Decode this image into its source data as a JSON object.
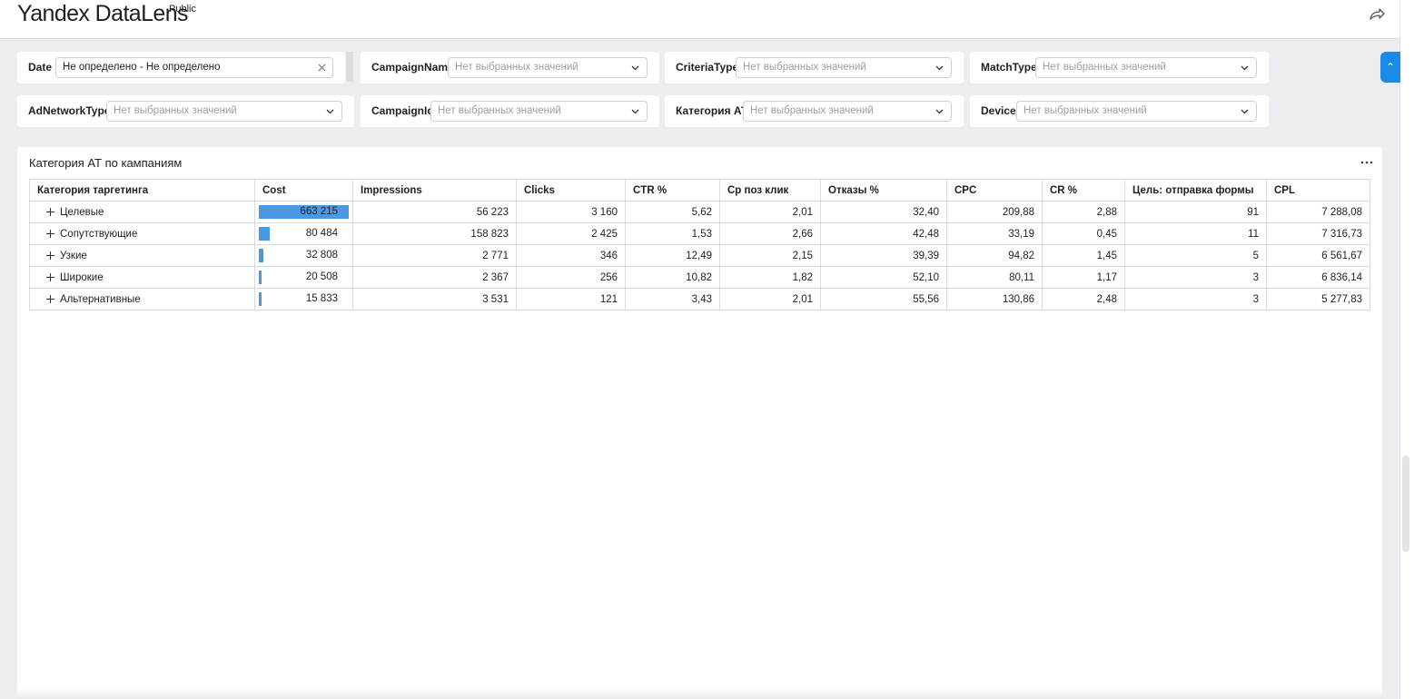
{
  "header": {
    "logo": "Yandex DataLens",
    "badge": "Public",
    "share_icon": "share-arrow-icon"
  },
  "filters": {
    "date": {
      "label": "Date",
      "value": "Не определено - Не определено"
    },
    "campaign_name": {
      "label": "CampaignName",
      "placeholder": "Нет выбранных значений"
    },
    "criteria_type": {
      "label": "CriteriaType",
      "placeholder": "Нет выбранных значений"
    },
    "match_type": {
      "label": "MatchType",
      "placeholder": "Нет выбранных значений"
    },
    "ad_network_type": {
      "label": "AdNetworkType",
      "placeholder": "Нет выбранных значений"
    },
    "campaign_id": {
      "label": "CampaignId",
      "placeholder": "Нет выбранных значений"
    },
    "category_at": {
      "label": "Категория АТ",
      "placeholder": "Нет выбранных значений"
    },
    "device": {
      "label": "Device",
      "placeholder": "Нет выбранных значений"
    }
  },
  "panel": {
    "title": "Категория АТ по кампаниям",
    "more_icon": "ellipsis-icon"
  },
  "table": {
    "columns": [
      "Категория таргетинга",
      "Cost",
      "Impressions",
      "Clicks",
      "CTR %",
      "Ср поз клик",
      "Отказы %",
      "CPC",
      "CR %",
      "Цель: отправка формы",
      "CPL"
    ],
    "rows": [
      {
        "cat": "Целевые",
        "cost": "663 215",
        "cost_fraction": 1.0,
        "impressions": "56 223",
        "clicks": "3 160",
        "ctr": "5,62",
        "pos": "2,01",
        "bounce": "32,40",
        "cpc": "209,88",
        "cr": "2,88",
        "goal": "91",
        "cpl": "7 288,08"
      },
      {
        "cat": "Сопутствующие",
        "cost": "80 484",
        "cost_fraction": 0.121,
        "impressions": "158 823",
        "clicks": "2 425",
        "ctr": "1,53",
        "pos": "2,66",
        "bounce": "42,48",
        "cpc": "33,19",
        "cr": "0,45",
        "goal": "11",
        "cpl": "7 316,73"
      },
      {
        "cat": "Узкие",
        "cost": "32 808",
        "cost_fraction": 0.049,
        "impressions": "2 771",
        "clicks": "346",
        "ctr": "12,49",
        "pos": "2,15",
        "bounce": "39,39",
        "cpc": "94,82",
        "cr": "1,45",
        "goal": "5",
        "cpl": "6 561,67"
      },
      {
        "cat": "Широкие",
        "cost": "20 508",
        "cost_fraction": 0.031,
        "impressions": "2 367",
        "clicks": "256",
        "ctr": "10,82",
        "pos": "1,82",
        "bounce": "52,10",
        "cpc": "80,11",
        "cr": "1,17",
        "goal": "3",
        "cpl": "6 836,14"
      },
      {
        "cat": "Альтернативные",
        "cost": "15 833",
        "cost_fraction": 0.024,
        "impressions": "3 531",
        "clicks": "121",
        "ctr": "3,43",
        "pos": "2,01",
        "bounce": "55,56",
        "cpc": "130,86",
        "cr": "2,48",
        "goal": "3",
        "cpl": "5 277,83"
      }
    ]
  },
  "colors": {
    "accent": "#1a8ae6",
    "bar": "#4a99e5",
    "background": "#ebedf0"
  }
}
